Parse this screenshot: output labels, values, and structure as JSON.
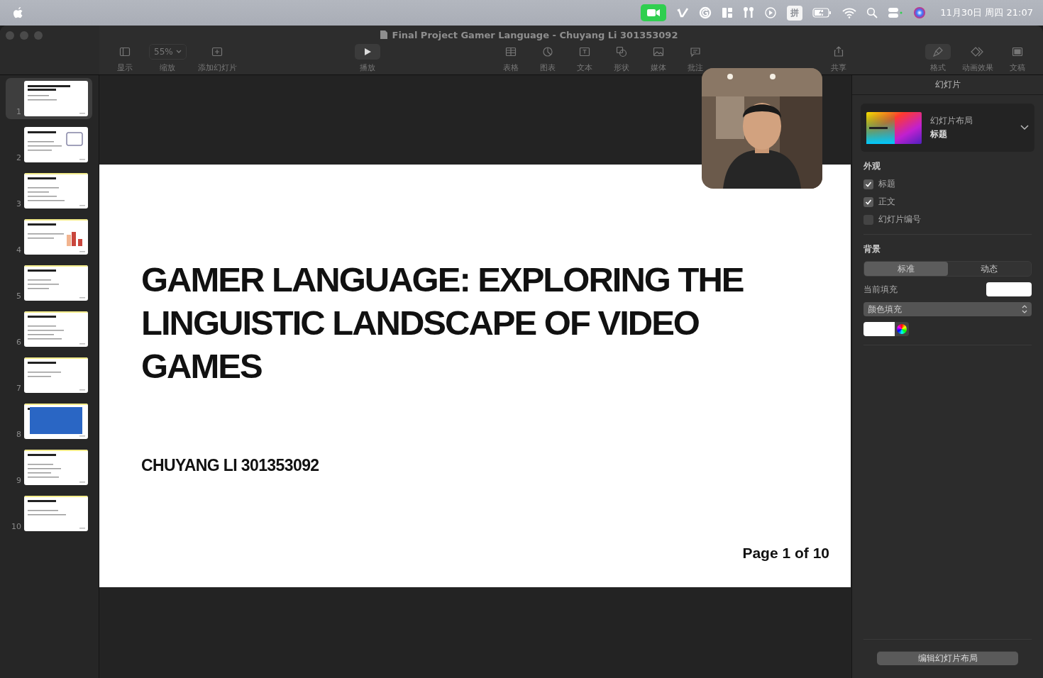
{
  "menu_bar": {
    "status_items": [
      {
        "kind": "facetime"
      },
      {
        "kind": "vimeo"
      },
      {
        "kind": "grammarly"
      },
      {
        "kind": "layout"
      },
      {
        "kind": "airpods"
      },
      {
        "kind": "play"
      },
      {
        "kind": "input",
        "label": "拼"
      },
      {
        "kind": "battery"
      },
      {
        "kind": "wifi"
      },
      {
        "kind": "search"
      },
      {
        "kind": "control"
      },
      {
        "kind": "siri"
      }
    ],
    "clock": "11月30日 周四 21:07"
  },
  "window": {
    "title": "Final Project Gamer Language - Chuyang Li 301353092"
  },
  "toolbar": {
    "left": [
      {
        "kind": "sidebar",
        "label": "显示"
      },
      {
        "kind": "zoom",
        "label": "缩放",
        "value": "55%"
      },
      {
        "kind": "add",
        "label": "添加幻灯片"
      }
    ],
    "play": {
      "label": "播放"
    },
    "middle": [
      {
        "kind": "table",
        "label": "表格"
      },
      {
        "kind": "chart",
        "label": "图表"
      },
      {
        "kind": "text",
        "label": "文本"
      },
      {
        "kind": "shape",
        "label": "形状"
      },
      {
        "kind": "media",
        "label": "媒体"
      },
      {
        "kind": "comment",
        "label": "批注"
      }
    ],
    "share": {
      "label": "共享"
    },
    "right": [
      {
        "kind": "format",
        "label": "格式",
        "selected": true
      },
      {
        "kind": "animate",
        "label": "动画效果",
        "selected": false
      },
      {
        "kind": "document",
        "label": "文稿",
        "selected": false
      }
    ]
  },
  "slides": [
    {
      "number": "1",
      "selected": true
    },
    {
      "number": "2",
      "selected": false
    },
    {
      "number": "3",
      "selected": false
    },
    {
      "number": "4",
      "selected": false
    },
    {
      "number": "5",
      "selected": false
    },
    {
      "number": "6",
      "selected": false
    },
    {
      "number": "7",
      "selected": false
    },
    {
      "number": "8",
      "selected": false
    },
    {
      "number": "9",
      "selected": false
    },
    {
      "number": "10",
      "selected": false
    }
  ],
  "slide": {
    "title": "GAMER LANGUAGE: EXPLORING THE LINGUISTIC LANDSCAPE OF VIDEO GAMES",
    "subtitle": "CHUYANG LI 301353092",
    "footer": "Page 1 of 10"
  },
  "inspector": {
    "heading": "幻灯片",
    "layout": {
      "label": "幻灯片布局",
      "value": "标题"
    },
    "appearance": {
      "heading": "外观",
      "options": [
        {
          "label": "标题",
          "checked": true
        },
        {
          "label": "正文",
          "checked": true
        },
        {
          "label": "幻灯片编号",
          "checked": false
        }
      ]
    },
    "background": {
      "heading": "背景",
      "modes": [
        {
          "label": "标准",
          "selected": true
        },
        {
          "label": "动态",
          "selected": false
        }
      ],
      "current_fill_label": "当前填充",
      "fill_type": "颜色填充"
    },
    "edit_button": "编辑幻灯片布局"
  }
}
